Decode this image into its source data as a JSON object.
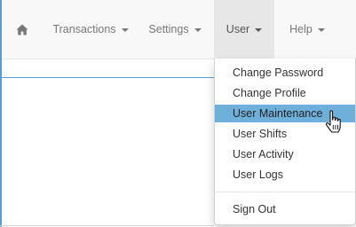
{
  "navbar": {
    "home_icon": "home-icon",
    "items": [
      {
        "label": "Transactions"
      },
      {
        "label": "Settings"
      },
      {
        "label": "User"
      },
      {
        "label": "Help"
      }
    ],
    "active_item": "User"
  },
  "user_menu": {
    "items": [
      {
        "label": "Change Password"
      },
      {
        "label": "Change Profile"
      },
      {
        "label": "User Maintenance"
      },
      {
        "label": "User Shifts"
      },
      {
        "label": "User Activity"
      },
      {
        "label": "User Logs"
      }
    ],
    "highlighted_item": "User Maintenance",
    "sign_out": {
      "label": "Sign Out"
    }
  },
  "colors": {
    "accent": "#5b9bd5",
    "highlight": "#6fb0db",
    "navbar_bg": "#f8f8f8",
    "active_bg": "#e7e7e7"
  },
  "cursor_icon": "hand-pointer-icon"
}
